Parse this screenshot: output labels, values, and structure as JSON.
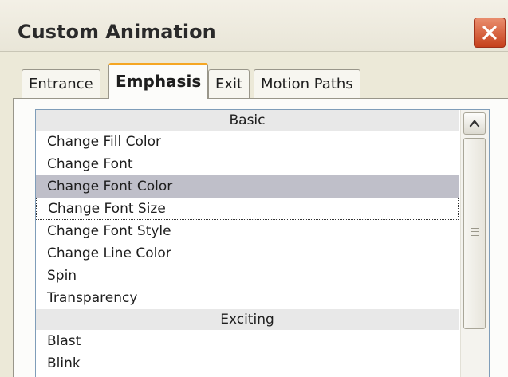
{
  "window": {
    "title": "Custom Animation",
    "close_icon": "close-icon"
  },
  "tabs": [
    {
      "label": "Entrance",
      "active": false
    },
    {
      "label": "Emphasis",
      "active": true
    },
    {
      "label": "Exit",
      "active": false
    },
    {
      "label": "Motion Paths",
      "active": false
    }
  ],
  "effects_list": {
    "groups": [
      {
        "header": "Basic",
        "items": [
          "Change Fill Color",
          "Change Font",
          "Change Font Color",
          "Change Font Size",
          "Change Font Style",
          "Change Line Color",
          "Spin",
          "Transparency"
        ]
      },
      {
        "header": "Exciting",
        "items": [
          "Blast",
          "Blink"
        ]
      }
    ],
    "selected_item": "Change Font Color",
    "focused_item": "Change Font Size"
  },
  "scrollbar": {
    "up_icon": "chevron-up-icon",
    "grip_icon": "scroll-grip-icon"
  }
}
